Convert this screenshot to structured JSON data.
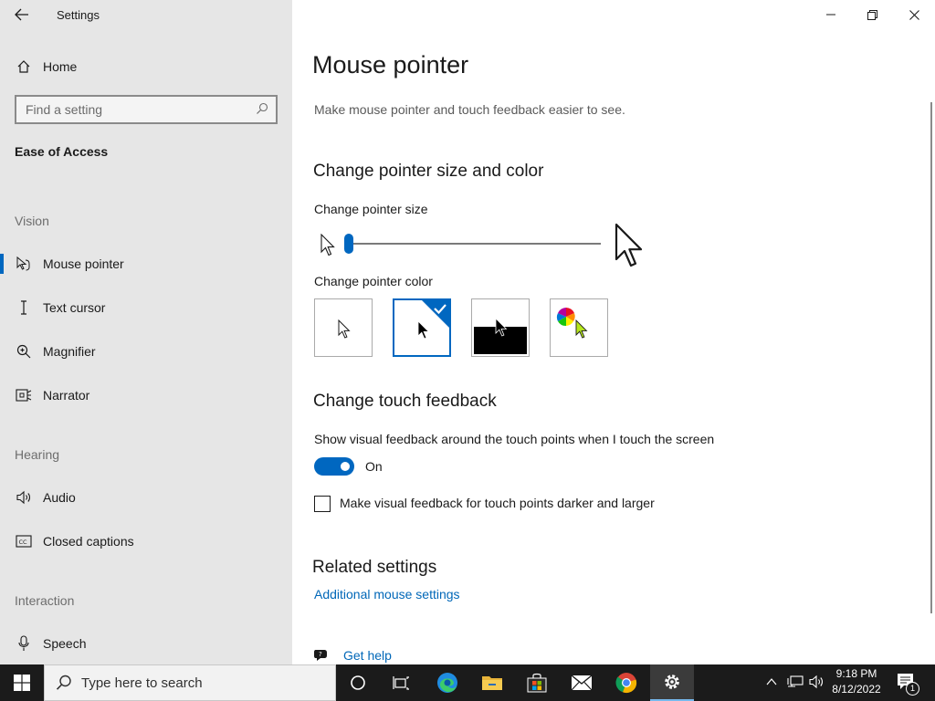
{
  "window": {
    "title": "Settings",
    "controls": {
      "minimize": "minimize",
      "maximize": "restore",
      "close": "close"
    }
  },
  "sidebar": {
    "home_label": "Home",
    "search_placeholder": "Find a setting",
    "category": "Ease of Access",
    "sections": [
      {
        "heading": "Vision",
        "items": [
          {
            "label": "Mouse pointer",
            "icon": "mouse-pointer-icon",
            "active": true
          },
          {
            "label": "Text cursor",
            "icon": "text-cursor-icon"
          },
          {
            "label": "Magnifier",
            "icon": "magnifier-icon"
          },
          {
            "label": "Narrator",
            "icon": "narrator-icon"
          }
        ]
      },
      {
        "heading": "Hearing",
        "items": [
          {
            "label": "Audio",
            "icon": "audio-icon"
          },
          {
            "label": "Closed captions",
            "icon": "closed-captions-icon"
          }
        ]
      },
      {
        "heading": "Interaction",
        "items": [
          {
            "label": "Speech",
            "icon": "microphone-icon"
          }
        ]
      }
    ]
  },
  "main": {
    "title": "Mouse pointer",
    "description": "Make mouse pointer and touch feedback easier to see.",
    "pointer_section": {
      "heading": "Change pointer size and color",
      "size_label": "Change pointer size",
      "size_value": 1,
      "color_label": "Change pointer color",
      "color_options": [
        {
          "name": "white",
          "selected": false
        },
        {
          "name": "black",
          "selected": true
        },
        {
          "name": "inverted",
          "selected": false
        },
        {
          "name": "custom",
          "selected": false
        }
      ]
    },
    "touch_section": {
      "heading": "Change touch feedback",
      "feedback_label": "Show visual feedback around the touch points when I touch the screen",
      "toggle_state": "On",
      "checkbox_label": "Make visual feedback for touch points darker and larger",
      "checkbox_checked": false
    },
    "related": {
      "heading": "Related settings",
      "link": "Additional mouse settings"
    },
    "help": {
      "label": "Get help"
    }
  },
  "taskbar": {
    "search_placeholder": "Type here to search",
    "apps": [
      "cortana",
      "task-view",
      "edge",
      "file-explorer",
      "store",
      "mail",
      "chrome",
      "settings"
    ],
    "time": "9:18 PM",
    "date": "8/12/2022",
    "notification_count": "1"
  },
  "colors": {
    "accent": "#0067c0",
    "sidebar_bg": "#e6e6e6",
    "taskbar_bg": "#1b1b1b",
    "link": "#0067b8"
  }
}
